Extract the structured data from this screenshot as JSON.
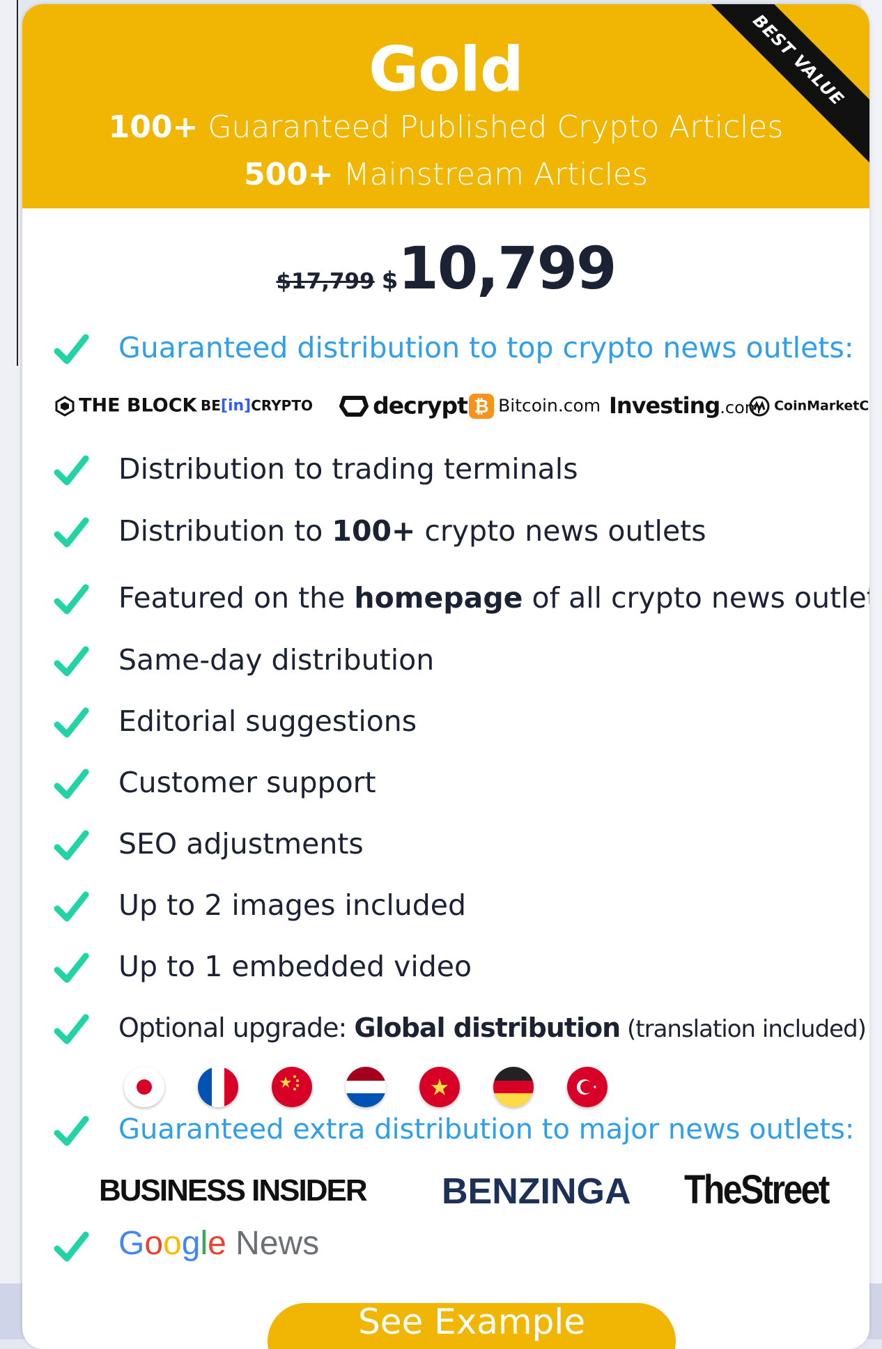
{
  "plan": {
    "name": "Gold",
    "ribbon": "BEST VALUE",
    "line1_bold": "100+",
    "line1_text": " Guaranteed Published Crypto Articles",
    "line2_bold": "500+",
    "line2_text": " Mainstream Articles",
    "old_price": "$17,799",
    "currency": "$",
    "price": "10,799",
    "cta_label": "See Example"
  },
  "features": [
    {
      "text": "Guaranteed distribution to top crypto news outlets:"
    },
    {
      "text": "Distribution to trading terminals"
    },
    {
      "pre": "Distribution to ",
      "bold": "100+",
      "post": " crypto news outlets"
    },
    {
      "pre": "Featured on the ",
      "bold": "homepage",
      "post": " of all crypto news outlets"
    },
    {
      "text": "Same-day distribution"
    },
    {
      "text": "Editorial suggestions"
    },
    {
      "text": "Customer support"
    },
    {
      "text": "SEO adjustments"
    },
    {
      "text": "Up to 2 images included"
    },
    {
      "text": "Up to 1 embedded video"
    },
    {
      "pre": "Optional upgrade: ",
      "bold": "Global distribution",
      "post": " (translation included)"
    },
    {
      "text": "Guaranteed extra distribution to major news outlets:"
    }
  ],
  "crypto_outlets": {
    "the_block": "THE BLOCK",
    "be_prefix": "BE",
    "be_in": "[in]",
    "be_crypto": "CRYPTO",
    "decrypt": "decrypt",
    "bitcoin": "Bitcoin.com",
    "investing": "Investing",
    "investing_suffix": ".com",
    "coinmarketcap": "CoinMarketCap"
  },
  "flags": [
    "japan",
    "france",
    "china",
    "netherlands",
    "vietnam",
    "germany",
    "turkey"
  ],
  "major_outlets": {
    "business_insider": "BUSINESS INSIDER",
    "benzinga": "BENZINGA",
    "thestreet": "TheStreet",
    "google_news_g": "G",
    "google_news_o1": "o",
    "google_news_o2": "o",
    "google_news_g2": "g",
    "google_news_l": "l",
    "google_news_e": "e",
    "google_news_word": " News"
  },
  "colors": {
    "gold": "#f0b603",
    "check": "#22d3a6",
    "blue_text": "#2e9fe8",
    "dark_text": "#1a2233"
  }
}
